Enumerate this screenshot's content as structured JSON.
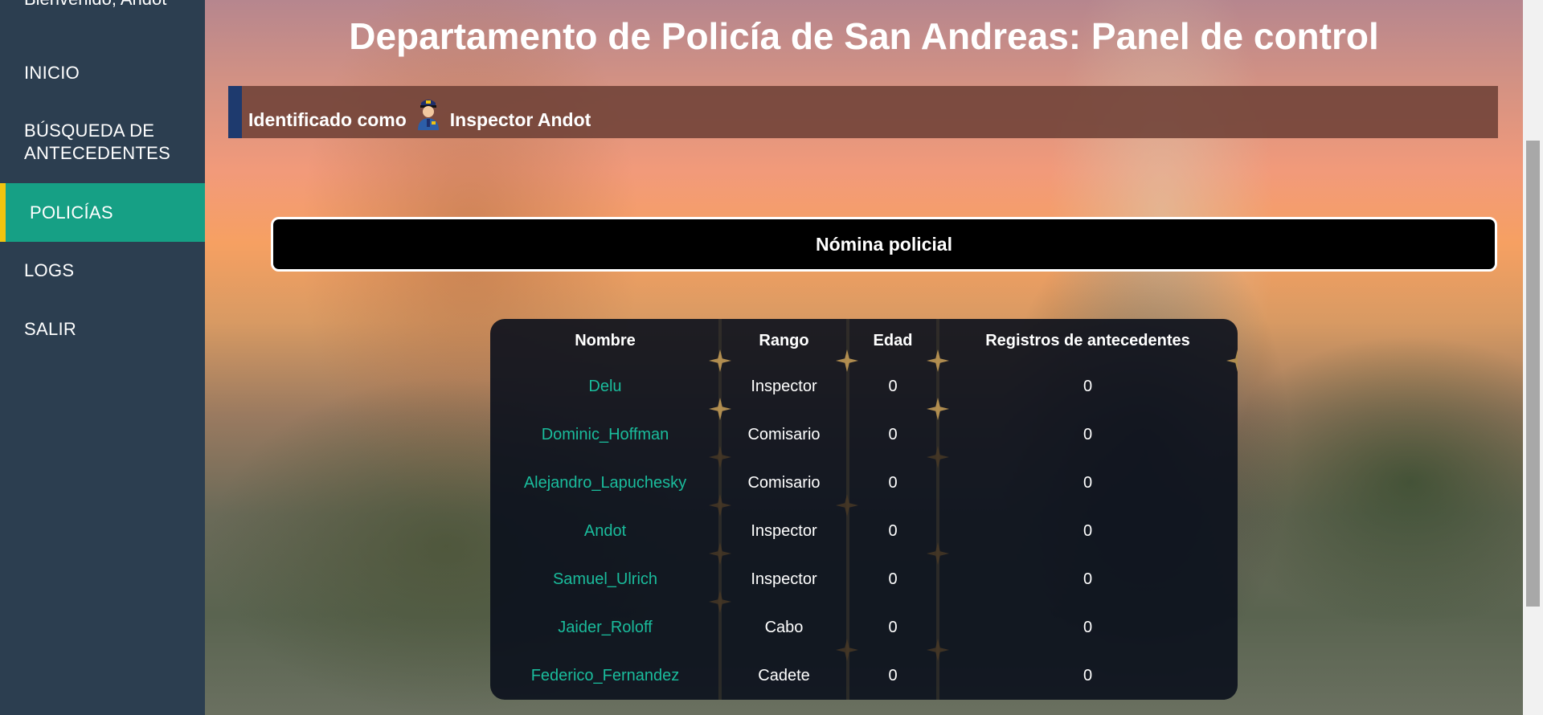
{
  "sidebar": {
    "welcome": "Bienvenido, Andot",
    "items": [
      {
        "label": "INICIO"
      },
      {
        "label": "BÚSQUEDA DE"
      },
      {
        "label": "ANTECEDENTES"
      },
      {
        "label": "POLICÍAS"
      },
      {
        "label": "LOGS"
      },
      {
        "label": "SALIR"
      }
    ],
    "active_color": "#16a085",
    "active_marker_color": "#f1c40f",
    "bg_color": "#2c3e50"
  },
  "header": {
    "title": "Departamento de Policía de San Andreas: Panel de control"
  },
  "identity": {
    "prefix": "Identificado como",
    "icon": "police-officer-icon",
    "user": "Inspector Andot"
  },
  "section": {
    "title": "Nómina policial"
  },
  "table": {
    "columns": [
      "Nombre",
      "Rango",
      "Edad",
      "Registros de antecedentes"
    ],
    "rows": [
      [
        "Delu",
        "Inspector",
        "0",
        "0"
      ],
      [
        "Dominic_Hoffman",
        "Comisario",
        "0",
        "0"
      ],
      [
        "Alejandro_Lapuchesky",
        "Comisario",
        "0",
        "0"
      ],
      [
        "Andot",
        "Inspector",
        "0",
        "0"
      ],
      [
        "Samuel_Ulrich",
        "Inspector",
        "0",
        "0"
      ],
      [
        "Jaider_Roloff",
        "Cabo",
        "0",
        "0"
      ],
      [
        "Federico_Fernandez",
        "Cadete",
        "0",
        "0"
      ]
    ],
    "name_color": "#1abc9c"
  }
}
